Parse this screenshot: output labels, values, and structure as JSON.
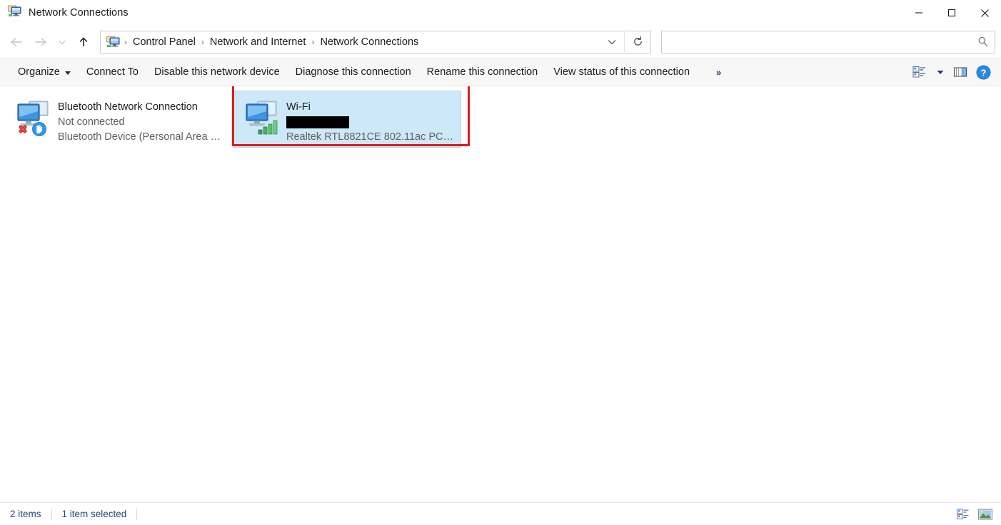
{
  "window": {
    "title": "Network Connections",
    "icon": "network-connections-icon",
    "controls": {
      "minimize": "minimize-icon",
      "maximize": "maximize-icon",
      "close": "close-icon"
    }
  },
  "navbar": {
    "back": "back-arrow-icon",
    "forward": "forward-arrow-icon",
    "recent": "chevron-down-icon",
    "up": "up-arrow-icon",
    "breadcrumbs": [
      {
        "label": "Control Panel"
      },
      {
        "label": "Network and Internet"
      },
      {
        "label": "Network Connections"
      }
    ],
    "separator": "›",
    "address_chevron": "chevron-down-icon",
    "refresh": "refresh-icon",
    "search": {
      "value": "",
      "placeholder": "",
      "icon": "search-icon"
    }
  },
  "commandbar": {
    "items": [
      {
        "label": "Organize",
        "has_caret": true
      },
      {
        "label": "Connect To",
        "has_caret": false
      },
      {
        "label": "Disable this network device",
        "has_caret": false
      },
      {
        "label": "Diagnose this connection",
        "has_caret": false
      },
      {
        "label": "Rename this connection",
        "has_caret": false
      },
      {
        "label": "View status of this connection",
        "has_caret": false
      }
    ],
    "overflow": "»",
    "right_icons": [
      {
        "name": "change-view-icon"
      },
      {
        "name": "change-view-dropdown-icon"
      },
      {
        "name": "preview-pane-icon"
      },
      {
        "name": "help-icon",
        "label": "?"
      }
    ]
  },
  "connections": [
    {
      "name": "Bluetooth Network Connection",
      "status": "Not connected",
      "device": "Bluetooth Device (Personal Area …",
      "icon": "network-adapter-icon",
      "badges": [
        "red-x-icon",
        "bluetooth-icon"
      ],
      "selected": false,
      "redacted": false
    },
    {
      "name": "Wi-Fi",
      "status": "",
      "device": "Realtek RTL8821CE 802.11ac PCIe …",
      "icon": "network-adapter-icon",
      "badges": [
        "wifi-signal-icon"
      ],
      "selected": true,
      "redacted": true
    }
  ],
  "annotation": {
    "color": "#e01b1b",
    "target": "wi-fi-connection-tile"
  },
  "statusbar": {
    "item_count": "2 items",
    "selection": "1 item selected",
    "view_buttons": [
      {
        "name": "details-view-button"
      },
      {
        "name": "large-icons-view-button"
      }
    ]
  },
  "colors": {
    "selection_fill": "#cde8f9",
    "selection_border": "#a8d8f0",
    "annotation_red": "#e01b1b",
    "status_text": "#1b4a78",
    "command_bar_bg": "#f7f7f7"
  }
}
